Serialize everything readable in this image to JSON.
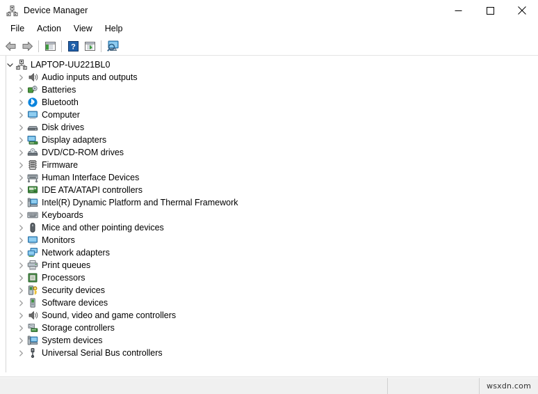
{
  "window": {
    "title": "Device Manager",
    "icon": "device-manager-icon",
    "controls": {
      "minimize": "minimize-icon",
      "maximize": "maximize-icon",
      "close": "close-icon"
    }
  },
  "menubar": {
    "items": [
      {
        "label": "File",
        "name": "menu-file"
      },
      {
        "label": "Action",
        "name": "menu-action"
      },
      {
        "label": "View",
        "name": "menu-view"
      },
      {
        "label": "Help",
        "name": "menu-help"
      }
    ]
  },
  "toolbar": {
    "buttons": [
      {
        "name": "back-button",
        "icon": "back-arrow-icon"
      },
      {
        "name": "forward-button",
        "icon": "forward-arrow-icon"
      },
      {
        "name": "show-hide-console-tree-button",
        "icon": "console-tree-icon"
      },
      {
        "name": "help-button",
        "icon": "question-mark-icon"
      },
      {
        "name": "properties-button",
        "icon": "properties-window-icon"
      },
      {
        "name": "scan-for-hardware-changes-button",
        "icon": "scan-hardware-icon"
      }
    ]
  },
  "tree": {
    "root": {
      "label": "LAPTOP-UU221BL0",
      "icon": "computer-node-icon",
      "expanded": true,
      "twisty": "chevron-down-icon"
    },
    "nodes": [
      {
        "label": "Audio inputs and outputs",
        "icon": "speaker-icon"
      },
      {
        "label": "Batteries",
        "icon": "battery-icon"
      },
      {
        "label": "Bluetooth",
        "icon": "bluetooth-icon"
      },
      {
        "label": "Computer",
        "icon": "monitor-icon"
      },
      {
        "label": "Disk drives",
        "icon": "disk-drive-icon"
      },
      {
        "label": "Display adapters",
        "icon": "display-adapter-icon"
      },
      {
        "label": "DVD/CD-ROM drives",
        "icon": "optical-drive-icon"
      },
      {
        "label": "Firmware",
        "icon": "firmware-chip-icon"
      },
      {
        "label": "Human Interface Devices",
        "icon": "hid-icon"
      },
      {
        "label": "IDE ATA/ATAPI controllers",
        "icon": "ide-controller-icon"
      },
      {
        "label": "Intel(R) Dynamic Platform and Thermal Framework",
        "icon": "system-device-icon"
      },
      {
        "label": "Keyboards",
        "icon": "keyboard-icon"
      },
      {
        "label": "Mice and other pointing devices",
        "icon": "mouse-icon"
      },
      {
        "label": "Monitors",
        "icon": "monitor-icon"
      },
      {
        "label": "Network adapters",
        "icon": "network-adapter-icon"
      },
      {
        "label": "Print queues",
        "icon": "printer-icon"
      },
      {
        "label": "Processors",
        "icon": "processor-icon"
      },
      {
        "label": "Security devices",
        "icon": "security-device-icon"
      },
      {
        "label": "Software devices",
        "icon": "software-device-icon"
      },
      {
        "label": "Sound, video and game controllers",
        "icon": "speaker-icon"
      },
      {
        "label": "Storage controllers",
        "icon": "storage-controller-icon"
      },
      {
        "label": "System devices",
        "icon": "system-device-icon"
      },
      {
        "label": "Universal Serial Bus controllers",
        "icon": "usb-icon"
      }
    ],
    "collapsed_twisty": "chevron-right-icon"
  },
  "statusbar": {
    "pane1": "",
    "pane2": "",
    "watermark": "wsxdn.com"
  },
  "colors": {
    "accent_blue": "#1a7fd4",
    "bluetooth_blue": "#0a84dd",
    "monitor_blue": "#3f9fe0",
    "green": "#3e9b3e",
    "toolbar_gray": "#8c8c8c",
    "status_bg": "#f0f0f0"
  }
}
